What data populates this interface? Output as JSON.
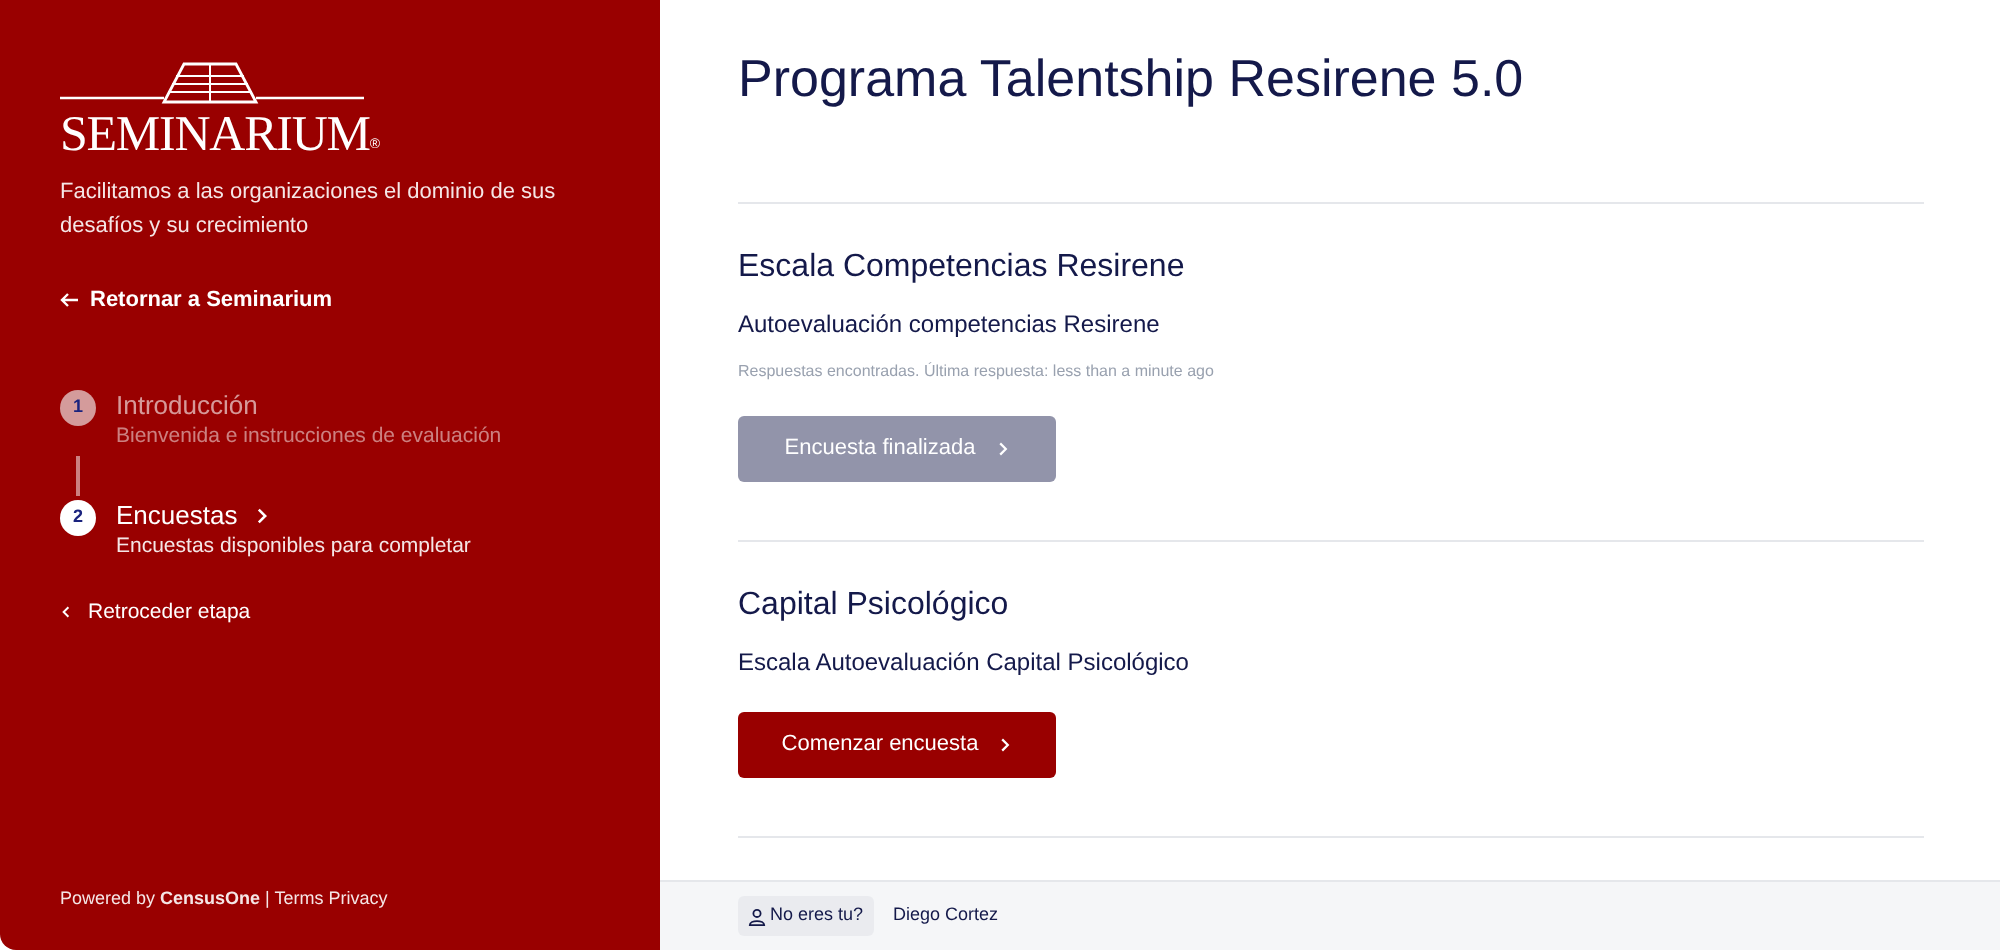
{
  "sidebar": {
    "logo": {
      "name": "SEMINARIUM",
      "mark": "®"
    },
    "tagline": "Facilitamos a las organizaciones el dominio de sus desafíos y su crecimiento",
    "back_link": "Retornar a Seminarium",
    "steps": [
      {
        "number": "1",
        "title": "Introducción",
        "subtitle": "Bienvenida e instrucciones de evaluación",
        "selected": false
      },
      {
        "number": "2",
        "title": "Encuestas",
        "subtitle": "Encuestas disponibles para completar",
        "selected": true
      }
    ],
    "previous_step": "Retroceder etapa",
    "footer": "Powered by **CensusOne** | Terms Privacy"
  },
  "main": {
    "title": "Programa Talentship Resirene 5.0",
    "surveys": [
      {
        "title": "Escala Competencias Resirene",
        "subtitle": "Autoevaluación competencias Resirene",
        "note": "Respuestas encontradas. Última respuesta: less than a minute ago",
        "button": "Encuesta finalizada",
        "disabled": true
      },
      {
        "title": "Capital Psicológico",
        "subtitle": "Escala Autoevaluación Capital Psicológico",
        "button": "Comenzar encuesta",
        "disabled": false
      }
    ]
  },
  "user_bar": {
    "button": "No eres tu?",
    "user": "Diego Cortez"
  }
}
